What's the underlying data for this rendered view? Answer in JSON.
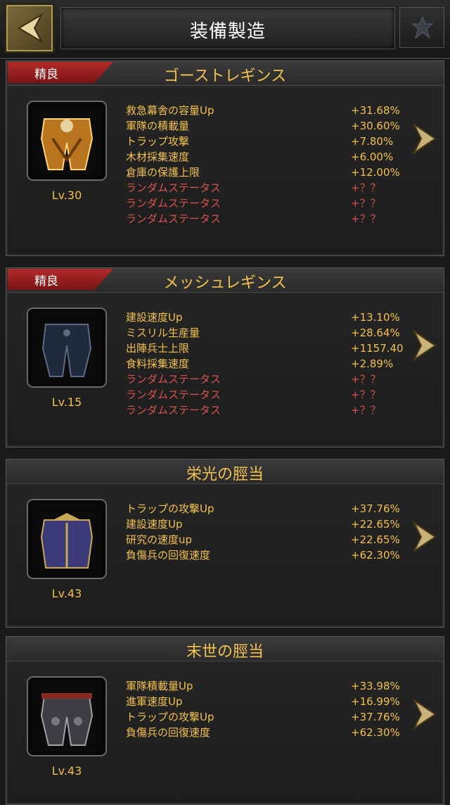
{
  "header": {
    "title": "装備製造"
  },
  "items": [
    {
      "badge": "精良",
      "name": "ゴーストレギンス",
      "level": "Lv.30",
      "stats": [
        {
          "name": "救急幕舎の容量Up",
          "value": "+31.68%"
        },
        {
          "name": "軍隊の積載量",
          "value": "+30.60%"
        },
        {
          "name": "トラップ攻撃",
          "value": "+7.80%"
        },
        {
          "name": "木材採集速度",
          "value": "+6.00%"
        },
        {
          "name": "倉庫の保護上限",
          "value": "+12.00%"
        },
        {
          "name": "ランダムステータス",
          "value": "+？？"
        },
        {
          "name": "ランダムステータス",
          "value": "+？？"
        },
        {
          "name": "ランダムステータス",
          "value": "+？？"
        }
      ]
    },
    {
      "badge": "精良",
      "name": "メッシュレギンス",
      "level": "Lv.15",
      "stats": [
        {
          "name": "建設速度Up",
          "value": "+13.10%"
        },
        {
          "name": "ミスリル生産量",
          "value": "+28.64%"
        },
        {
          "name": "出陣兵士上限",
          "value": "+1157.40"
        },
        {
          "name": "食料採集速度",
          "value": "+2.89%"
        },
        {
          "name": "ランダムステータス",
          "value": "+？？"
        },
        {
          "name": "ランダムステータス",
          "value": "+？？"
        },
        {
          "name": "ランダムステータス",
          "value": "+？？"
        }
      ]
    },
    {
      "badge": "",
      "name": "栄光の脛当",
      "level": "Lv.43",
      "stats": [
        {
          "name": "トラップの攻撃Up",
          "value": "+37.76%"
        },
        {
          "name": "建設速度Up",
          "value": "+22.65%"
        },
        {
          "name": "研究の速度up",
          "value": "+22.65%"
        },
        {
          "name": "負傷兵の回復速度",
          "value": "+62.30%"
        }
      ]
    },
    {
      "badge": "",
      "name": "末世の脛当",
      "level": "Lv.43",
      "stats": [
        {
          "name": "軍隊積載量Up",
          "value": "+33.98%"
        },
        {
          "name": "進軍速度Up",
          "value": "+16.99%"
        },
        {
          "name": "トラップの攻撃Up",
          "value": "+37.76%"
        },
        {
          "name": "負傷兵の回復速度",
          "value": "+62.30%"
        }
      ]
    }
  ],
  "colors": {
    "gold": "#f2c14e",
    "random": "#d9534f",
    "badge": "#b22a2a"
  },
  "icons": [
    "back-arrow-icon",
    "guild-emblem-icon",
    "ghost-leggings-icon",
    "mesh-leggings-icon",
    "glory-greaves-icon",
    "doom-greaves-icon",
    "next-arrow-icon"
  ]
}
